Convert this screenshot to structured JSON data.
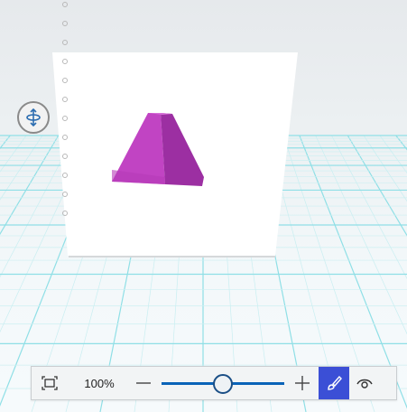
{
  "toolbar": {
    "zoom_label": "100%",
    "zoom_fraction": 0.49,
    "fit_icon": "fit-to-view-icon",
    "minus_icon": "zoom-out-minus-icon",
    "plus_icon": "zoom-in-plus-icon",
    "paint_icon": "paintbrush-icon",
    "view_icon": "view-eye-icon",
    "accent_color": "#3b4fd6",
    "slider_color": "#0a63b8"
  },
  "canvas": {
    "orbit_icon": "orbit-view-icon",
    "shape_name": "pyramid",
    "shape_colors": {
      "left_face": "#bf3fc0",
      "right_face": "#9a2ea0",
      "top_face": "#d56ad6"
    }
  }
}
